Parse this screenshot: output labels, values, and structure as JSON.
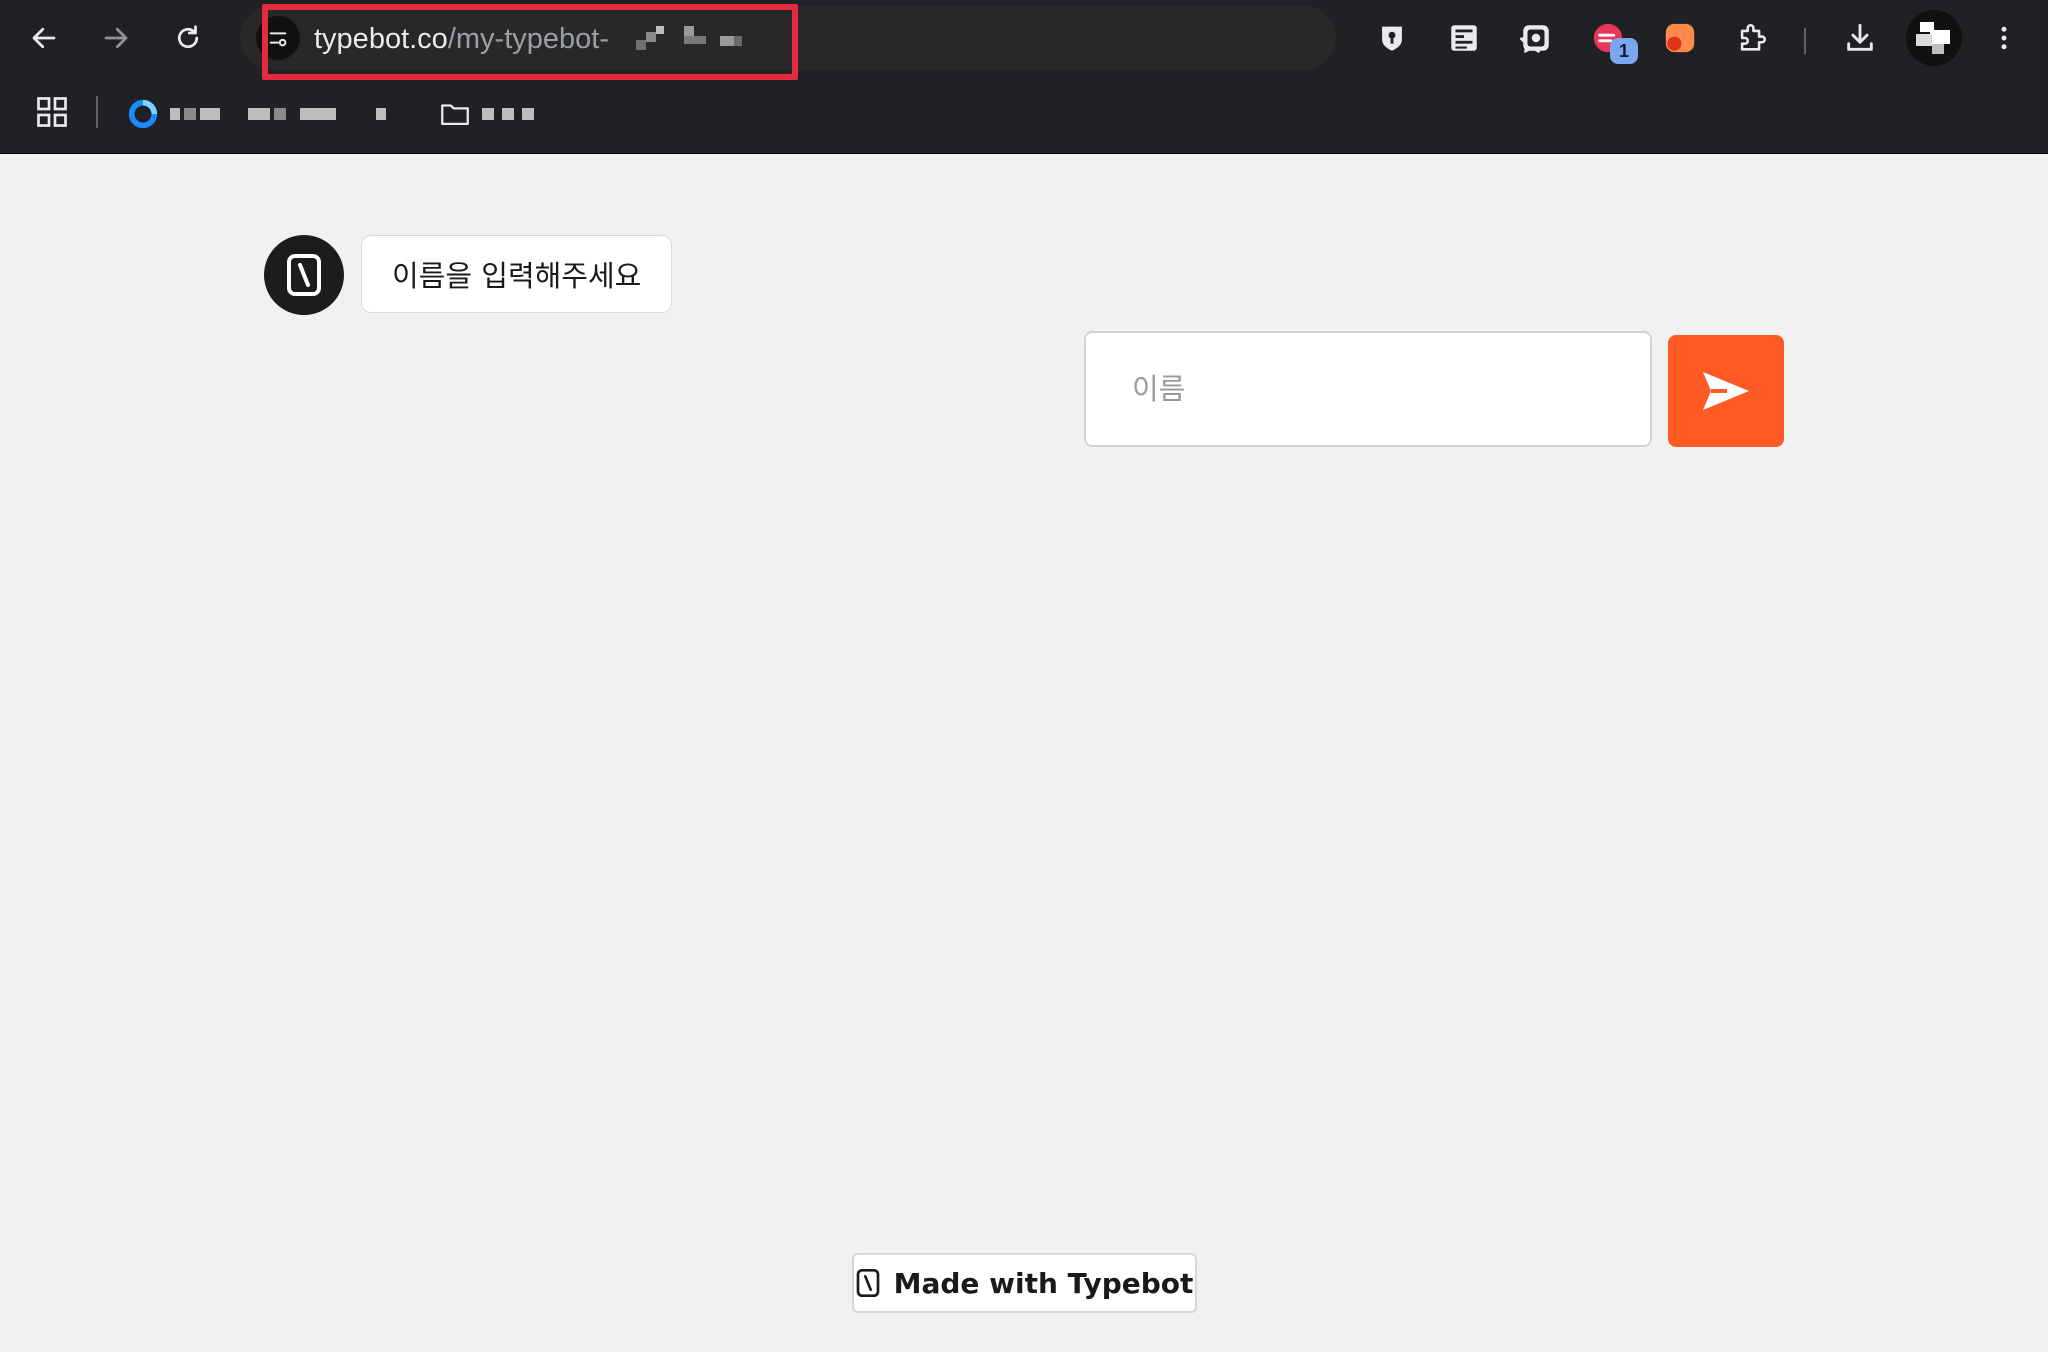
{
  "browser": {
    "url_host": "typebot.co",
    "url_path": "/my-typebot-",
    "extension_badge": "1",
    "icons": {
      "back": "arrow-left-icon",
      "forward": "arrow-right-icon",
      "reload": "reload-icon",
      "site_info": "tune-icon",
      "bookmark_star": "star-icon",
      "extensions": "puzzle-icon",
      "downloads": "download-icon",
      "menu": "kebab-menu-icon",
      "apps": "apps-grid-icon",
      "folder": "folder-icon"
    }
  },
  "chat": {
    "bot_message": "이름을 입력해주세요",
    "input_placeholder": "이름",
    "input_value": "",
    "send_icon": "send-arrow-icon",
    "accent_color": "#ff5924"
  },
  "footer": {
    "branding_label": "Made with Typebot"
  }
}
